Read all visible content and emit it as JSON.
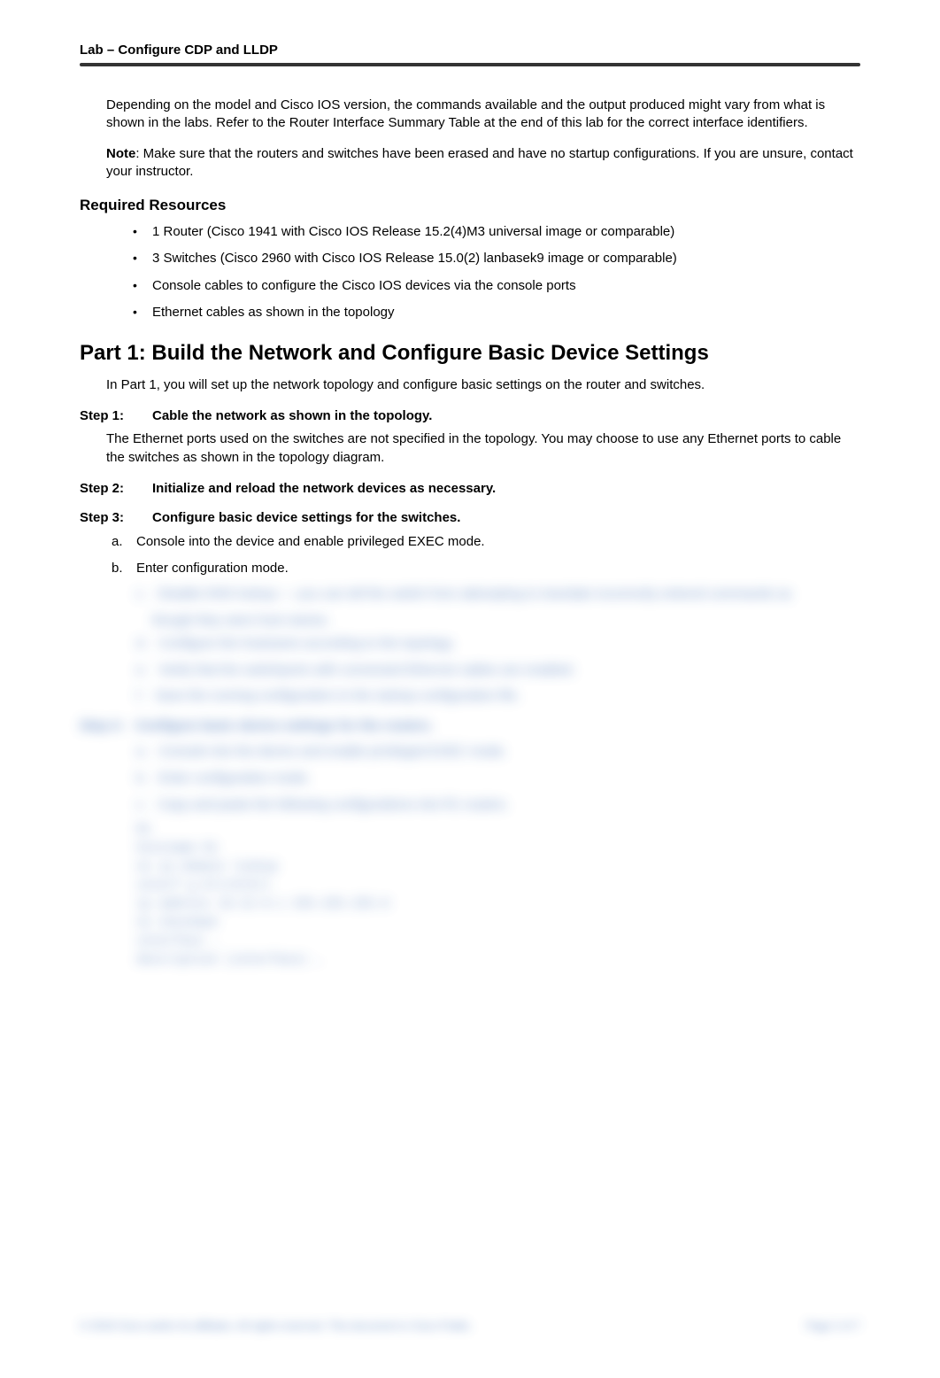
{
  "header": {
    "title": "Lab – Configure CDP and LLDP"
  },
  "intro": {
    "p1": "Depending on the model and Cisco IOS version, the commands available and the output produced might vary from what is shown in the labs. Refer to the Router Interface Summary Table at the end of this lab for the correct interface identifiers.",
    "note_label": "Note",
    "note_text": ": Make sure that the routers and switches have been erased and have no startup configurations. If you are unsure, contact your instructor."
  },
  "required": {
    "heading": "Required Resources",
    "items": [
      "1 Router (Cisco 1941 with Cisco IOS Release 15.2(4)M3 universal image or comparable)",
      "3 Switches (Cisco 2960 with Cisco IOS Release 15.0(2) lanbasek9 image or comparable)",
      "Console cables to configure the Cisco IOS devices via the console ports",
      "Ethernet cables as shown in the topology"
    ]
  },
  "part1": {
    "heading": "Part 1:   Build the Network and Configure Basic Device Settings",
    "intro": "In Part 1, you will set up the network topology and configure basic settings on the router and switches."
  },
  "step1": {
    "label": "Step 1:",
    "title": "Cable the network as shown in the topology.",
    "body": "The Ethernet ports used on the switches are not specified in the topology. You may choose to use any Ethernet ports to cable the switches as shown in the topology diagram."
  },
  "step2": {
    "label": "Step 2:",
    "title": "Initialize and reload the network devices as necessary."
  },
  "step3": {
    "label": "Step 3:",
    "title": "Configure basic device settings for the switches.",
    "items": {
      "a": "Console into the device and enable privileged EXEC mode.",
      "b": "Enter configuration mode."
    }
  },
  "blurred": {
    "c_line1": "Disable DNS lookup — you can tell the switch from attempting to translate incorrectly entered commands as",
    "c_line2": "though they were host names.",
    "d": "Configure the hostname according to the topology.",
    "e": "Verify that the switchports with connected Ethernet cables are enabled.",
    "f": "Save the running configuration to the startup configuration file.",
    "step4_label": "Step 4:",
    "step4_title": "Configure basic device settings for the routers.",
    "s4a": "Console into the device and enable privileged EXEC mode.",
    "s4b": "Enter configuration mode.",
    "s4c": "Copy and paste the following configurations into R1 routers.",
    "r1": "R1",
    "code": [
      "hostname R1",
      "no ip domain lookup",
      "interf g 0/1/0/0/1",
      "  ip address 10.22.0.1 255.255.255.0",
      "  no shutdown",
      "",
      "interface …",
      "description (interface) …"
    ]
  },
  "footer": {
    "left": "© 2018 Cisco and/or its affiliates. All rights reserved. This document is Cisco Public.",
    "right": "Page 2 of 7"
  }
}
